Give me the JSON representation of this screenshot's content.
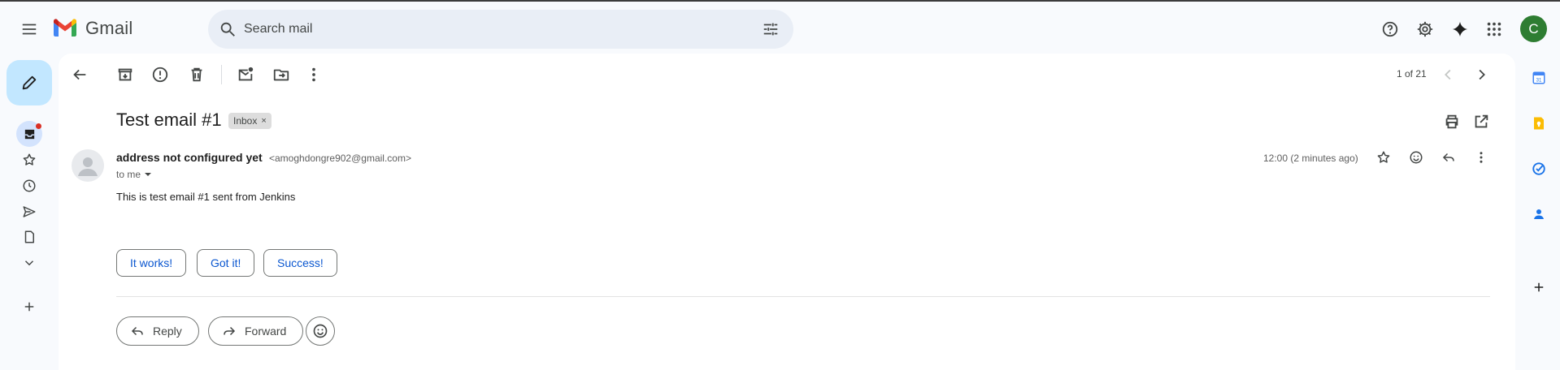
{
  "app": {
    "logo_text": "Gmail"
  },
  "search": {
    "placeholder": "Search mail"
  },
  "account": {
    "avatar_letter": "C"
  },
  "pagination": {
    "counter": "1 of 21"
  },
  "message": {
    "subject": "Test email #1",
    "label": "Inbox",
    "label_remove": "×",
    "sender_name": "address not configured yet",
    "sender_email": "<amoghdongre902@gmail.com>",
    "recipient": "to me",
    "timestamp": "12:00 (2 minutes ago)",
    "body": "This is test email #1 sent from Jenkins"
  },
  "smart_replies": [
    "It works!",
    "Got it!",
    "Success!"
  ],
  "actions": {
    "reply": "Reply",
    "forward": "Forward"
  },
  "colors": {
    "accent": "#0b57d0",
    "compose_bg": "#c2e7ff",
    "avatar_bg": "#2e7d32",
    "page_bg": "#f8fafd"
  }
}
